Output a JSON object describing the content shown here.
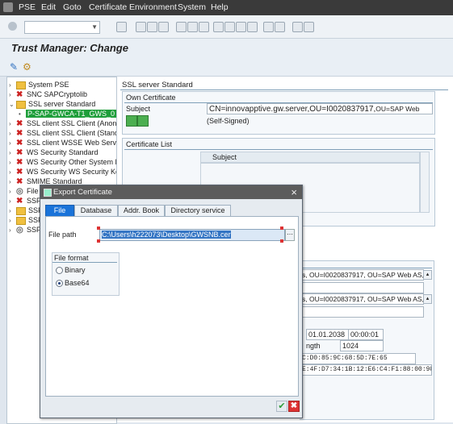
{
  "menubar": {
    "items": [
      "PSE",
      "Edit",
      "Goto",
      "Certificate",
      "Environment",
      "System",
      "Help"
    ],
    "underlines": [
      "P",
      "E",
      "G",
      "C",
      "n",
      "S",
      "H"
    ]
  },
  "page_title": "Trust Manager: Change",
  "tree": {
    "items": [
      {
        "label": "System PSE",
        "kind": "folder",
        "toggle": "›"
      },
      {
        "label": "SNC SAPCryptolib",
        "kind": "x",
        "toggle": "›"
      },
      {
        "label": "SSL server Standard",
        "kind": "folder",
        "toggle": "⌄"
      },
      {
        "label": "P-SAP-GWCA-T1_GWS_0",
        "kind": "selected",
        "toggle": "•"
      },
      {
        "label": "SSL client SSL Client (Anonym",
        "kind": "x",
        "toggle": "›"
      },
      {
        "label": "SSL client SSL Client (Standa",
        "kind": "x",
        "toggle": "›"
      },
      {
        "label": "SSL client WSSE Web Servic",
        "kind": "x",
        "toggle": "›"
      },
      {
        "label": "WS Security Standard",
        "kind": "x",
        "toggle": "›"
      },
      {
        "label": "WS Security Other System E",
        "kind": "x",
        "toggle": "›"
      },
      {
        "label": "WS Security WS Security Ke",
        "kind": "x",
        "toggle": "›"
      },
      {
        "label": "SMIME Standard",
        "kind": "x",
        "toggle": "›"
      },
      {
        "label": "File",
        "kind": "cert",
        "toggle": "›"
      },
      {
        "label": "SSF",
        "kind": "x",
        "toggle": "›"
      },
      {
        "label": "SSF",
        "kind": "folder",
        "toggle": "›"
      },
      {
        "label": "SSF",
        "kind": "folder",
        "toggle": "›"
      },
      {
        "label": "SSF",
        "kind": "cert",
        "toggle": "›"
      }
    ]
  },
  "right": {
    "section_title": "SSL server Standard",
    "own_cert": {
      "title": "Own Certificate",
      "subject_label": "Subject",
      "subject_value": "CN=innovapptive.gw.server,OU=I0020837917,",
      "subject_value_small": "OU=SAP Web",
      "self_signed": "(Self-Signed)"
    },
    "cert_list": {
      "title": "Certificate List",
      "col_subject": "Subject"
    },
    "details": {
      "owner_tail": "s, OU=I0020837917, OU=SAP Web AS, O",
      "issuer_tail": "s, OU=I0020837917, OU=SAP Web AS, O",
      "valid_to_date": "01.01.2038",
      "valid_to_time": "00:00:01",
      "key_length_label": "ngth",
      "key_length": "1024",
      "fp1": "C:D0:85:9C:68:5D:7E:65",
      "fp2": "E:4F:D7:34:1B:12:E6:C4:F1:88:00:98"
    }
  },
  "dialog": {
    "title": "Export Certificate",
    "close": "×",
    "tabs": [
      "File",
      "Database",
      "Addr. Book",
      "Directory service"
    ],
    "file_path_label": "File path",
    "file_path_value": "C:\\Users\\h222073\\Desktop\\GWSNB.cer",
    "file_format_title": "File format",
    "formats": [
      "Binary",
      "Base64"
    ],
    "selected_format": "Base64",
    "ok": "✔",
    "cancel": "✖"
  }
}
